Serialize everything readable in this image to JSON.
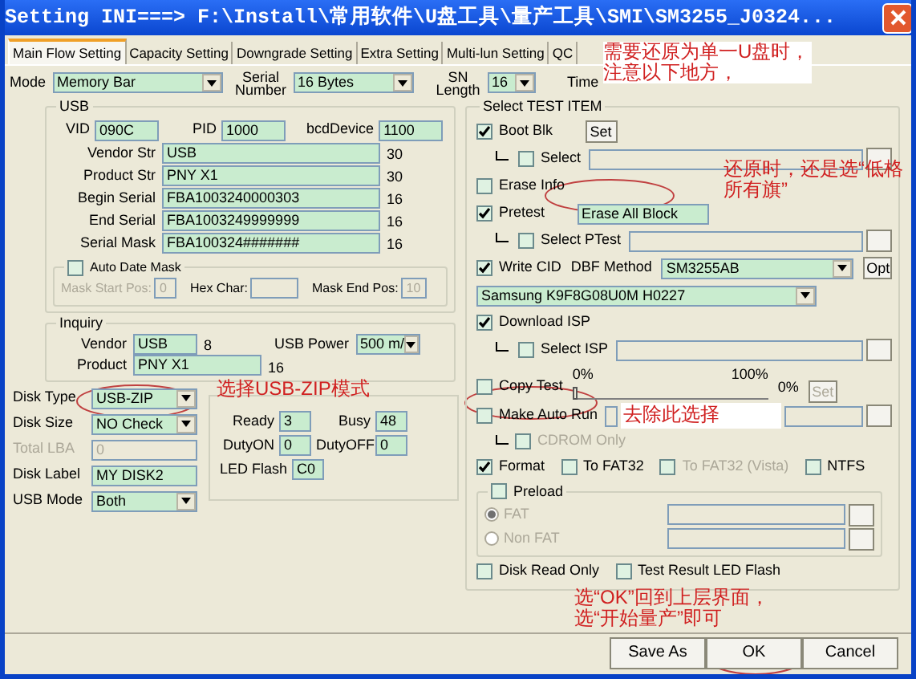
{
  "window": {
    "title": "Setting  INI===> F:\\Install\\常用软件\\U盘工具\\量产工具\\SMI\\SM3255_J0324..."
  },
  "tabs": [
    {
      "label": "Main Flow Setting",
      "selected": true
    },
    {
      "label": "Capacity Setting",
      "selected": false
    },
    {
      "label": "Downgrade Setting",
      "selected": false
    },
    {
      "label": "Extra Setting",
      "selected": false
    },
    {
      "label": "Multi-lun Setting",
      "selected": false
    },
    {
      "label": "QC",
      "selected": false
    }
  ],
  "top_row": {
    "mode": {
      "label": "Mode",
      "value": "Memory Bar"
    },
    "serial_number": {
      "label": "Serial Number",
      "value": "16 Bytes"
    },
    "sn_length": {
      "label": "SN Length",
      "value": "16"
    },
    "time_label": "Time"
  },
  "usb": {
    "title": "USB",
    "vid": {
      "label": "VID",
      "value": "090C"
    },
    "pid": {
      "label": "PID",
      "value": "1000"
    },
    "bcd_device": {
      "label": "bcdDevice",
      "value": "1100"
    },
    "strings": [
      {
        "label": "Vendor Str",
        "value": "USB",
        "max": "30"
      },
      {
        "label": "Product Str",
        "value": "PNY X1",
        "max": "30"
      },
      {
        "label": "Begin Serial",
        "value": "FBA1003240000303",
        "max": "16"
      },
      {
        "label": "End Serial",
        "value": "FBA1003249999999",
        "max": "16"
      },
      {
        "label": "Serial Mask",
        "value": "FBA100324#######",
        "max": "16"
      }
    ],
    "auto_date_mask": {
      "label": "Auto Date Mask",
      "checked": false,
      "mask_start": {
        "label": "Mask Start Pos:",
        "value": "0"
      },
      "hex_char": {
        "label": "Hex Char:"
      },
      "mask_end": {
        "label": "Mask End Pos:",
        "value": "10"
      }
    }
  },
  "inquiry": {
    "title": "Inquiry",
    "vendor": {
      "label": "Vendor",
      "value": "USB",
      "max": "8"
    },
    "product": {
      "label": "Product",
      "value": "PNY X1",
      "max": "16"
    },
    "usb_power": {
      "label": "USB Power",
      "value": "500 m/"
    }
  },
  "disk": [
    {
      "kind": "select",
      "label": "Disk Type",
      "value": "USB-ZIP",
      "disabled": false
    },
    {
      "kind": "select",
      "label": "Disk Size",
      "value": "NO Check",
      "disabled": false
    },
    {
      "kind": "text",
      "label": "Total LBA",
      "value": "0",
      "disabled": true
    },
    {
      "kind": "text",
      "label": "Disk Label",
      "value": "MY DISK2",
      "disabled": false
    },
    {
      "kind": "select",
      "label": "USB Mode",
      "value": "Both",
      "disabled": false
    }
  ],
  "led": {
    "rows": [
      [
        {
          "label": "Ready",
          "value": "3"
        },
        {
          "label": "Busy",
          "value": "48"
        }
      ],
      [
        {
          "label": "DutyON",
          "value": "0"
        },
        {
          "label": "DutyOFF",
          "value": "0"
        }
      ]
    ],
    "led_flash": {
      "label": "LED Flash",
      "value": "C0"
    }
  },
  "test_items": {
    "title": "Select TEST ITEM",
    "items": [
      {
        "kind": "check_button",
        "label": "Boot Blk",
        "checked": true,
        "button": "Set"
      },
      {
        "kind": "sub_browse",
        "label": "Select",
        "checked": false
      },
      {
        "kind": "check",
        "label": "Erase Info",
        "checked": false
      },
      {
        "kind": "check_field",
        "label": "Pretest",
        "checked": true,
        "value": "Erase All Block"
      },
      {
        "kind": "sub_browse",
        "label": "Select PTest",
        "checked": false
      },
      {
        "kind": "check_method",
        "label": "Write CID",
        "checked": true,
        "method_label": "DBF Method",
        "value": "SM3255AB",
        "button": "Opt"
      },
      {
        "kind": "dropdown",
        "value": "Samsung K9F8G08U0M H0227"
      },
      {
        "kind": "check",
        "label": "Download ISP",
        "checked": true
      },
      {
        "kind": "sub_browse",
        "label": "Select ISP",
        "checked": false
      },
      {
        "kind": "copy_test",
        "label": "Copy Test",
        "checked": false,
        "min": "0%",
        "max": "100%",
        "reading": "0%",
        "level": 0,
        "button": "Set"
      },
      {
        "kind": "check_browse",
        "label": "Make Auto Run",
        "checked": false
      },
      {
        "kind": "sub_check",
        "label": "CDROM Only",
        "checked": false,
        "disabled": true
      },
      {
        "kind": "check_row",
        "options": [
          {
            "label": "Format",
            "checked": true,
            "disabled": false
          },
          {
            "label": "To FAT32",
            "checked": false,
            "disabled": false
          },
          {
            "label": "To FAT32 (Vista)",
            "checked": false,
            "disabled": true
          },
          {
            "label": "NTFS",
            "checked": false,
            "disabled": false
          }
        ]
      },
      {
        "kind": "preload",
        "label": "Preload",
        "checked": false,
        "options": [
          {
            "label": "FAT",
            "selected": true
          },
          {
            "label": "Non FAT",
            "selected": false
          }
        ]
      },
      {
        "kind": "check_row",
        "options": [
          {
            "label": "Disk Read Only",
            "checked": false,
            "disabled": false
          },
          {
            "label": "Test Result LED Flash",
            "checked": false,
            "disabled": false
          }
        ]
      }
    ]
  },
  "buttons": [
    {
      "label": "Save As"
    },
    {
      "label": "OK"
    },
    {
      "label": "Cancel"
    }
  ],
  "annotations": [
    {
      "text": "需要还原为单一U盘时，注意以下地方，"
    },
    {
      "text": "还原时，还是选“低格所有旗”"
    },
    {
      "text": "选择USB-ZIP模式"
    },
    {
      "text": "去除此选择"
    },
    {
      "text": "选“OK”回到上层界面，选“开始量产”即可"
    }
  ]
}
